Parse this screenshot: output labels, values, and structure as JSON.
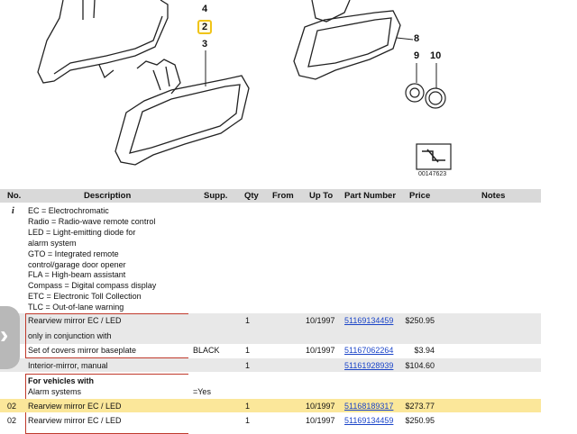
{
  "diagram": {
    "callouts": [
      "4",
      "2",
      "3",
      "8",
      "9",
      "10"
    ],
    "diagram_id": "00147623"
  },
  "table": {
    "headers": {
      "no": "No.",
      "description": "Description",
      "supp": "Supp.",
      "qty": "Qty",
      "from": "From",
      "upto": "Up To",
      "part": "Part Number",
      "price": "Price",
      "notes": "Notes"
    },
    "info_marker": "i",
    "info_lines": [
      "EC = Electrochromatic",
      "Radio = Radio-wave remote control",
      "LED = Light-emitting diode for",
      "alarm system",
      "GTO = Integrated remote",
      "control/garage door opener",
      "FLA = High-beam assistant",
      "Compass = Digital compass display",
      "ETC = Electronic Toll Collection",
      "TLC = Out-of-lane warning"
    ],
    "rows": [
      {
        "no": "",
        "desc": "Rearview mirror EC / LED",
        "supp": "",
        "qty": "1",
        "upto": "10/1997",
        "part": "51169134459",
        "price": "$250.95"
      },
      {
        "no": "",
        "desc": "only in conjunction with",
        "supp": "",
        "qty": "",
        "upto": "",
        "part": "",
        "price": ""
      },
      {
        "no": "",
        "desc": "Set of covers mirror baseplate",
        "supp": "BLACK",
        "qty": "1",
        "upto": "10/1997",
        "part": "51167062264",
        "price": "$3.94"
      },
      {
        "no": "",
        "desc": "Interior-mirror, manual",
        "supp": "",
        "qty": "1",
        "upto": "",
        "part": "51161928939",
        "price": "$104.60"
      },
      {
        "no": "",
        "desc": "For vehicles with",
        "supp": "",
        "qty": "",
        "upto": "",
        "part": "",
        "price": ""
      },
      {
        "no": "",
        "desc": "Alarm systems",
        "supp": "=Yes",
        "qty": "",
        "upto": "",
        "part": "",
        "price": ""
      },
      {
        "no": "02",
        "desc": "Rearview mirror EC / LED",
        "supp": "",
        "qty": "1",
        "upto": "10/1997",
        "part": "51168189317",
        "price": "$273.77"
      },
      {
        "no": "02",
        "desc": "Rearview mirror EC / LED",
        "supp": "",
        "qty": "1",
        "upto": "10/1997",
        "part": "51169134459",
        "price": "$250.95"
      }
    ]
  },
  "side_tab": {
    "glyph": "›"
  }
}
